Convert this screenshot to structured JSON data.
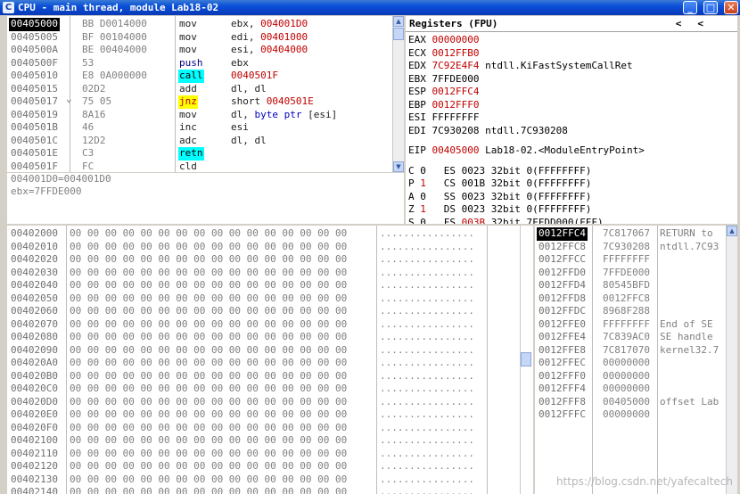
{
  "window": {
    "title": "CPU - main thread, module Lab18-02",
    "app_icon": "C",
    "controls": {
      "minimize": "_",
      "maximize": "□",
      "close": "✕"
    }
  },
  "disasm": {
    "rows": [
      {
        "addr": "00405000",
        "hex": "BB D0014000",
        "mnem": "mov",
        "ops": "ebx, ",
        "ops_hi": "004001D0",
        "selected": true
      },
      {
        "addr": "00405005",
        "hex": "BF 00104000",
        "mnem": "mov",
        "ops": "edi, ",
        "ops_hi": "00401000"
      },
      {
        "addr": "0040500A",
        "hex": "BE 00404000",
        "mnem": "mov",
        "ops": "esi, ",
        "ops_hi": "00404000"
      },
      {
        "addr": "0040500F",
        "hex": "53",
        "mnem": "push",
        "ops": "ebx",
        "ops_hi": ""
      },
      {
        "addr": "00405010",
        "hex": "E8 0A000000",
        "mnem": "call",
        "ops": "",
        "ops_hi": "0040501F"
      },
      {
        "addr": "00405015",
        "hex": "02D2",
        "mnem": "add",
        "ops": "dl, dl",
        "ops_hi": ""
      },
      {
        "addr": "00405017",
        "hex": "75 05",
        "mnem": "jnz",
        "ops": "short ",
        "ops_hi": "0040501E",
        "mark": "⌄"
      },
      {
        "addr": "00405019",
        "hex": "8A16",
        "mnem": "mov",
        "ops": "dl, ",
        "ops_kw": "byte ptr ",
        "ops_tail": "[esi]"
      },
      {
        "addr": "0040501B",
        "hex": "46",
        "mnem": "inc",
        "ops": "esi",
        "ops_hi": ""
      },
      {
        "addr": "0040501C",
        "hex": "12D2",
        "mnem": "adc",
        "ops": "dl, dl",
        "ops_hi": ""
      },
      {
        "addr": "0040501E",
        "hex": "C3",
        "mnem": "retn",
        "ops": "",
        "ops_hi": ""
      },
      {
        "addr": "0040501F",
        "hex": "FC",
        "mnem": "cld",
        "ops": "",
        "ops_hi": ""
      }
    ]
  },
  "info": {
    "line1": "004001D0=004001D0",
    "line2": "ebx=7FFDE000"
  },
  "registers": {
    "header": "Registers (FPU)",
    "nav_left": "<",
    "nav_right": "<",
    "gp": [
      {
        "name": "EAX",
        "value": "00000000",
        "red": true,
        "comment": ""
      },
      {
        "name": "ECX",
        "value": "0012FFB0",
        "red": true,
        "comment": ""
      },
      {
        "name": "EDX",
        "value": "7C92E4F4",
        "red": true,
        "comment": "ntdll.KiFastSystemCallRet"
      },
      {
        "name": "EBX",
        "value": "7FFDE000",
        "red": false,
        "comment": ""
      },
      {
        "name": "ESP",
        "value": "0012FFC4",
        "red": true,
        "comment": ""
      },
      {
        "name": "EBP",
        "value": "0012FFF0",
        "red": true,
        "comment": ""
      },
      {
        "name": "ESI",
        "value": "FFFFFFFF",
        "red": false,
        "comment": ""
      },
      {
        "name": "EDI",
        "value": "7C930208",
        "red": false,
        "comment": "ntdll.7C930208"
      }
    ],
    "eip": {
      "name": "EIP",
      "value": "00405000",
      "comment": "Lab18-02.<ModuleEntryPoint>"
    },
    "flags": [
      {
        "flag": "C",
        "bit": "0",
        "red": false,
        "seg": "ES",
        "sel": "0023",
        "selred": false,
        "desc": "32bit 0(FFFFFFFF)"
      },
      {
        "flag": "P",
        "bit": "1",
        "red": true,
        "seg": "CS",
        "sel": "001B",
        "selred": false,
        "desc": "32bit 0(FFFFFFFF)"
      },
      {
        "flag": "A",
        "bit": "0",
        "red": false,
        "seg": "SS",
        "sel": "0023",
        "selred": false,
        "desc": "32bit 0(FFFFFFFF)"
      },
      {
        "flag": "Z",
        "bit": "1",
        "red": true,
        "seg": "DS",
        "sel": "0023",
        "selred": false,
        "desc": "32bit 0(FFFFFFFF)"
      },
      {
        "flag": "S",
        "bit": "0",
        "red": false,
        "seg": "FS",
        "sel": "003B",
        "selred": true,
        "desc": "32bit 7FFDD000(FFF)"
      }
    ]
  },
  "dump": {
    "hex": "00 00 00 00 00 00 00 00 00 00 00 00 00 00 00 00",
    "ascii": "................",
    "rows": [
      "00402000",
      "00402010",
      "00402020",
      "00402030",
      "00402040",
      "00402050",
      "00402060",
      "00402070",
      "00402080",
      "00402090",
      "004020A0",
      "004020B0",
      "004020C0",
      "004020D0",
      "004020E0",
      "004020F0",
      "00402100",
      "00402110",
      "00402120",
      "00402130",
      "00402140"
    ]
  },
  "stack": {
    "rows": [
      {
        "addr": "0012FFC4",
        "value": "7C817067",
        "comment": "RETURN to",
        "selected": true
      },
      {
        "addr": "0012FFC8",
        "value": "7C930208",
        "comment": "ntdll.7C93"
      },
      {
        "addr": "0012FFCC",
        "value": "FFFFFFFF",
        "comment": ""
      },
      {
        "addr": "0012FFD0",
        "value": "7FFDE000",
        "comment": ""
      },
      {
        "addr": "0012FFD4",
        "value": "80545BFD",
        "comment": ""
      },
      {
        "addr": "0012FFD8",
        "value": "0012FFC8",
        "comment": ""
      },
      {
        "addr": "0012FFDC",
        "value": "8968F288",
        "comment": ""
      },
      {
        "addr": "0012FFE0",
        "value": "FFFFFFFF",
        "comment": "End of SE"
      },
      {
        "addr": "0012FFE4",
        "value": "7C839AC0",
        "comment": "SE handle"
      },
      {
        "addr": "0012FFE8",
        "value": "7C817070",
        "comment": "kernel32.7"
      },
      {
        "addr": "0012FFEC",
        "value": "00000000",
        "comment": ""
      },
      {
        "addr": "0012FFF0",
        "value": "00000000",
        "comment": ""
      },
      {
        "addr": "0012FFF4",
        "value": "00000000",
        "comment": ""
      },
      {
        "addr": "0012FFF8",
        "value": "00405000",
        "comment": "offset Lab"
      },
      {
        "addr": "0012FFFC",
        "value": "00000000",
        "comment": ""
      }
    ]
  },
  "watermark": "https://blog.csdn.net/yafecaltech",
  "colors": {
    "title_bar": "#0a4fd8",
    "changed_red": "#c00000",
    "call_highlight": "#00ffff",
    "jump_highlight": "#ffff00",
    "selection": "#000000"
  }
}
